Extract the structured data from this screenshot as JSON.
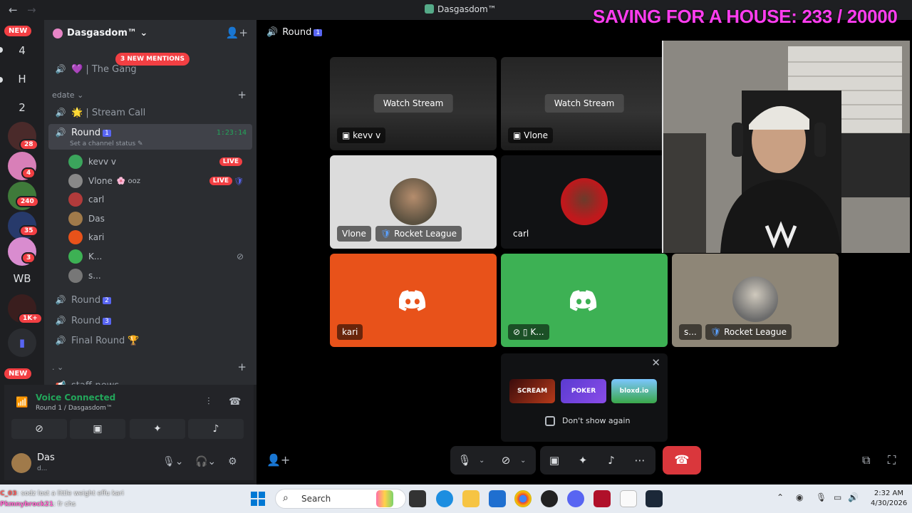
{
  "window": {
    "title": "Dasgasdom™",
    "banner": "SAVING FOR A HOUSE: 233 / 20000"
  },
  "rail": {
    "new_top": "NEW",
    "new_bottom": "NEW",
    "letters": [
      "4",
      "H",
      "2",
      "WB"
    ],
    "badges": [
      "28",
      "4",
      "240",
      "35",
      "3",
      "1K+"
    ]
  },
  "server": {
    "name": "Dasgasdom™",
    "mentions": "3 NEW MENTIONS",
    "channels": {
      "gang": "| The Gang",
      "category_edate": "edate",
      "stream_call": "|  Stream Call",
      "round1": "Round",
      "round1_num": "1",
      "round1_timer": "1:23:14",
      "round1_status": "Set a channel status",
      "round2": "Round",
      "round2_num": "2",
      "round3": "Round",
      "round3_num": "3",
      "final": "Final Round 🏆",
      "category_dot": ".",
      "staff": "staff-news"
    },
    "members": [
      {
        "name": "kevv v",
        "live": "LIVE"
      },
      {
        "name": "Vlone",
        "extra": "ooz",
        "live": "LIVE"
      },
      {
        "name": "carl"
      },
      {
        "name": "Das"
      },
      {
        "name": "kari"
      },
      {
        "name": "K..."
      },
      {
        "name": "s..."
      }
    ]
  },
  "voice": {
    "connected": "Voice Connected",
    "location": "Round 1 / Dasgasdom™"
  },
  "user": {
    "name": "Das",
    "status": "d..."
  },
  "stage": {
    "header": "Round",
    "header_num": "1",
    "tiles": {
      "t1_watch": "Watch Stream",
      "t1_name": "kevv v",
      "t2_watch": "Watch Stream",
      "t2_name": "Vlone",
      "t3_name": "Vlone",
      "t3_game": "Rocket League",
      "t4_name": "carl",
      "t5_name": "kari",
      "t6_name": "K...",
      "t7_name": "s...",
      "t7_game": "Rocket League"
    },
    "popup": {
      "games": [
        "SCREAM",
        "POKER",
        "bloxd.io"
      ],
      "dont_show": "Don't show again"
    }
  },
  "taskbar": {
    "search": "Search",
    "time": "2:32 AM",
    "date": "4/30/2026"
  },
  "chat_overlay": [
    {
      "user": "C_03",
      "msg": ": sodz lost a little weight effu kari"
    },
    {
      "user": "Pkmnybrock21",
      "msg": ": fr chs"
    }
  ],
  "colors": {
    "accent": "#5865f2",
    "live": "#f23f43",
    "connected": "#23a55a",
    "banner": "#ff3df0",
    "tile_orange": "#e8521a",
    "tile_green": "#3db154"
  }
}
